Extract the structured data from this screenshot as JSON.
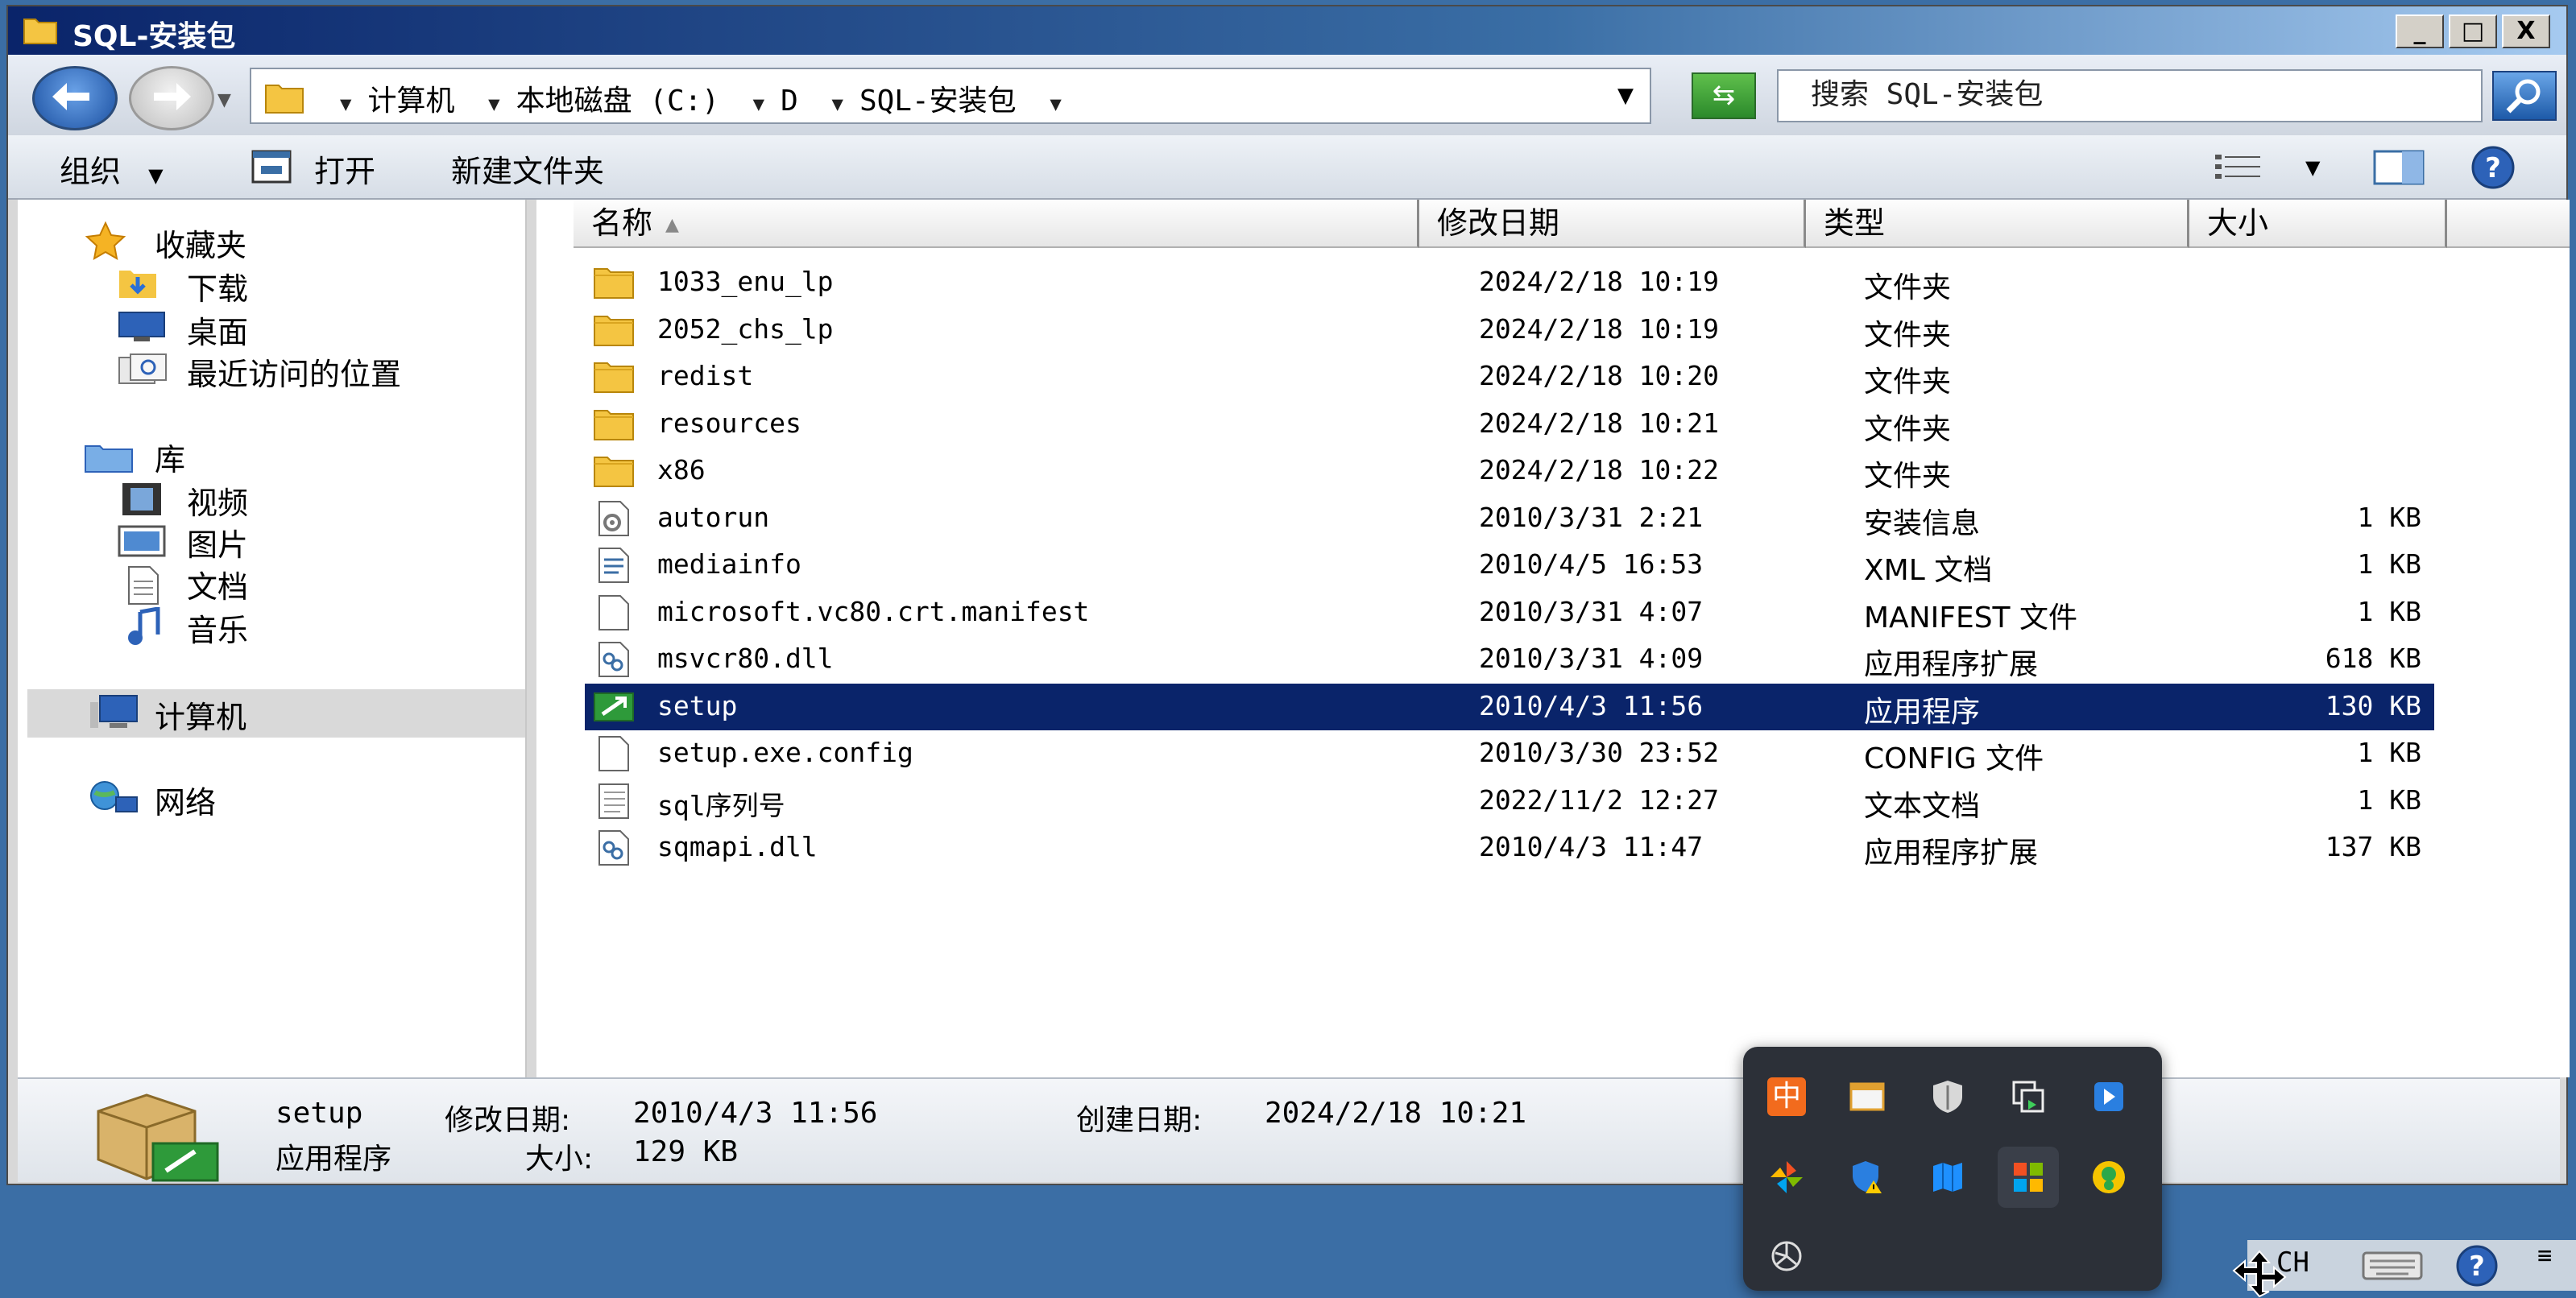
{
  "window": {
    "title": "SQL-安装包",
    "controls": [
      "_",
      "□",
      "X"
    ]
  },
  "address": {
    "crumbs": [
      "计算机",
      "本地磁盘 (C:)",
      "D",
      "SQL-安装包"
    ],
    "search_placeholder": "搜索 SQL-安装包"
  },
  "toolbar": {
    "organize": "组织",
    "open": "打开",
    "new_folder": "新建文件夹"
  },
  "nav": {
    "favorites": "收藏夹",
    "downloads": "下载",
    "desktop": "桌面",
    "recent": "最近访问的位置",
    "libraries": "库",
    "videos": "视频",
    "pictures": "图片",
    "documents": "文档",
    "music": "音乐",
    "computer": "计算机",
    "network": "网络"
  },
  "columns": {
    "name": "名称",
    "modified": "修改日期",
    "type": "类型",
    "size": "大小"
  },
  "files": [
    {
      "name": "1033_enu_lp",
      "modified": "2024/2/18 10:19",
      "type": "文件夹",
      "size": "",
      "icon": "folder-icon"
    },
    {
      "name": "2052_chs_lp",
      "modified": "2024/2/18 10:19",
      "type": "文件夹",
      "size": "",
      "icon": "folder-icon"
    },
    {
      "name": "redist",
      "modified": "2024/2/18 10:20",
      "type": "文件夹",
      "size": "",
      "icon": "folder-icon"
    },
    {
      "name": "resources",
      "modified": "2024/2/18 10:21",
      "type": "文件夹",
      "size": "",
      "icon": "folder-icon"
    },
    {
      "name": "x86",
      "modified": "2024/2/18 10:22",
      "type": "文件夹",
      "size": "",
      "icon": "folder-icon"
    },
    {
      "name": "autorun",
      "modified": "2010/3/31 2:21",
      "type": "安装信息",
      "size": "1 KB",
      "icon": "setup-info-icon"
    },
    {
      "name": "mediainfo",
      "modified": "2010/4/5 16:53",
      "type": "XML 文档",
      "size": "1 KB",
      "icon": "xml-file-icon"
    },
    {
      "name": "microsoft.vc80.crt.manifest",
      "modified": "2010/3/31 4:07",
      "type": "MANIFEST 文件",
      "size": "1 KB",
      "icon": "blank-file-icon"
    },
    {
      "name": "msvcr80.dll",
      "modified": "2010/3/31 4:09",
      "type": "应用程序扩展",
      "size": "618 KB",
      "icon": "dll-file-icon"
    },
    {
      "name": "setup",
      "modified": "2010/4/3 11:56",
      "type": "应用程序",
      "size": "130 KB",
      "icon": "setup-exe-icon",
      "selected": true
    },
    {
      "name": "setup.exe.config",
      "modified": "2010/3/30 23:52",
      "type": "CONFIG 文件",
      "size": "1 KB",
      "icon": "blank-file-icon"
    },
    {
      "name": "sql序列号",
      "modified": "2022/11/2 12:27",
      "type": "文本文档",
      "size": "1 KB",
      "icon": "text-file-icon"
    },
    {
      "name": "sqmapi.dll",
      "modified": "2010/4/3 11:47",
      "type": "应用程序扩展",
      "size": "137 KB",
      "icon": "dll-file-icon"
    }
  ],
  "details": {
    "name": "setup",
    "modified_label": "修改日期:",
    "modified_value": "2010/4/3 11:56",
    "created_label": "创建日期:",
    "created_value": "2024/2/18 10:21",
    "type": "应用程序",
    "size_label": "大小:",
    "size_value": "129 KB"
  },
  "tray": {
    "lang": "CH",
    "popup_ime": "中"
  },
  "colors": {
    "selection": "#0a246a",
    "desktop": "#3b6ea5",
    "popup_bg": "#2c3038"
  }
}
